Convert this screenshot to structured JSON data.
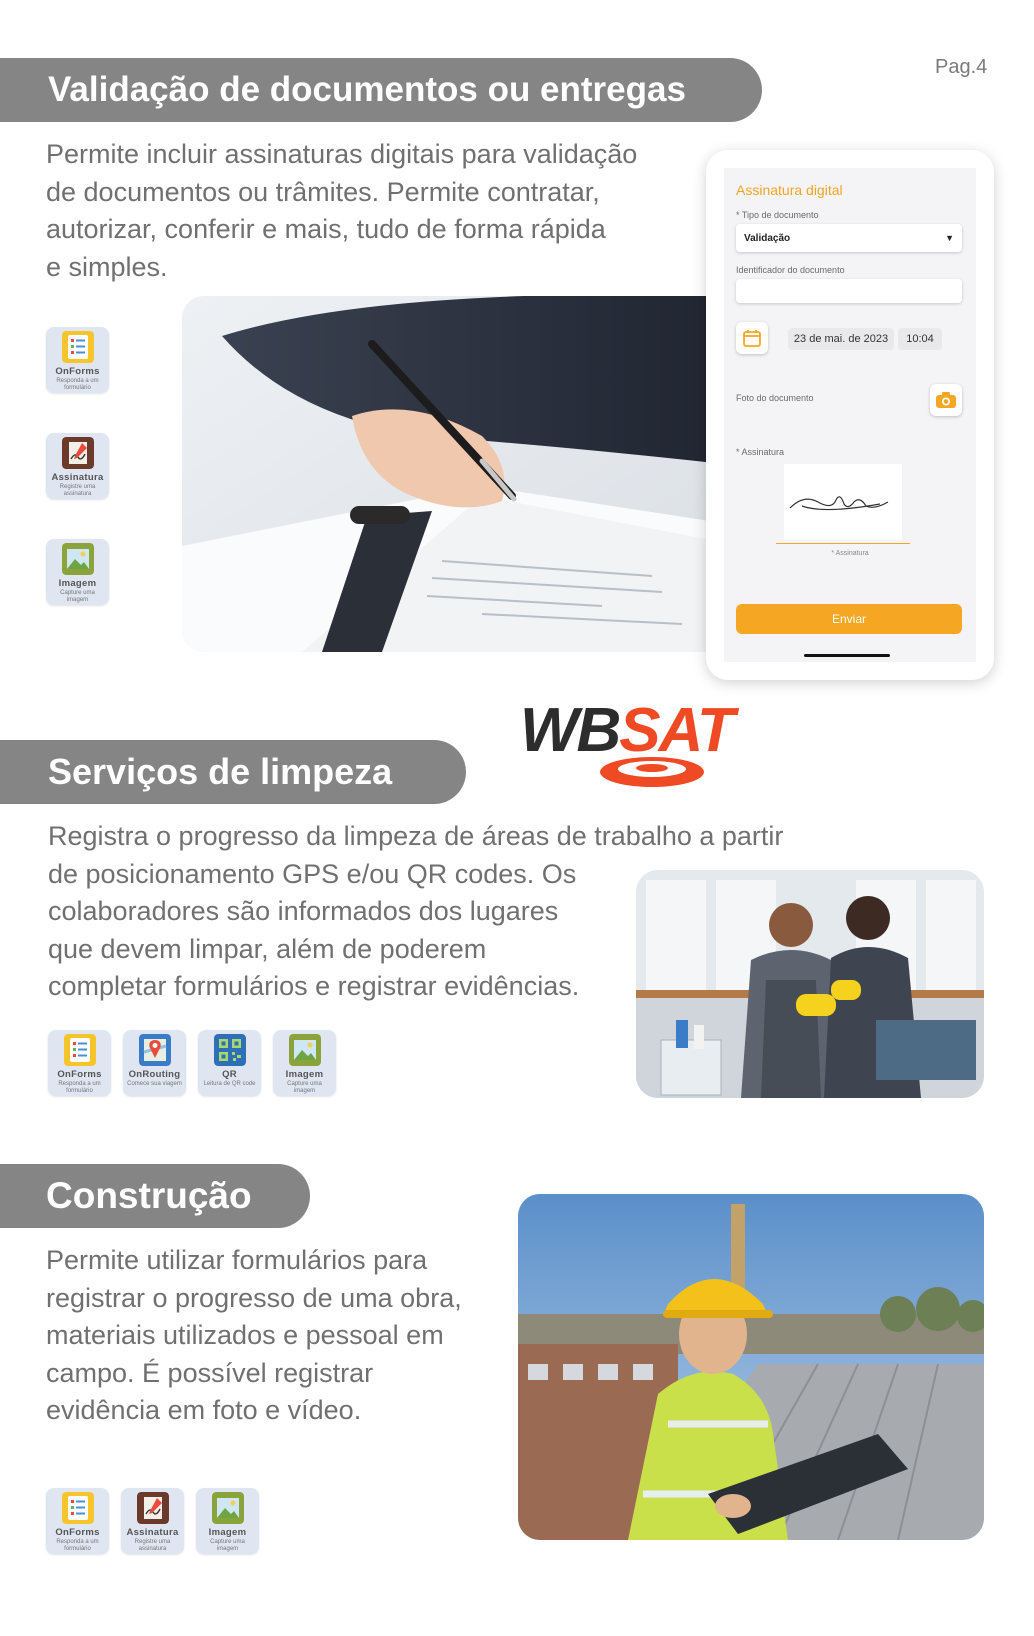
{
  "page_label": "Pag.4",
  "logo": {
    "text_left": "WB",
    "text_right": "SAT"
  },
  "sections": [
    {
      "title": "Validação de documentos ou entregas",
      "lines": [
        "Permite incluir assinaturas digitais para validação",
        "de documentos ou trâmites. Permite contratar,",
        "autorizar, conferir e mais, tudo de forma rápida",
        "e simples."
      ],
      "apps": [
        {
          "name": "OnForms",
          "sub": "Responda a um formulário"
        },
        {
          "name": "Assinatura",
          "sub": "Registre uma assinatura"
        },
        {
          "name": "Imagem",
          "sub": "Capture uma imagem"
        }
      ]
    },
    {
      "title": "Serviços de limpeza",
      "lines": [
        "Registra o progresso da limpeza de áreas de trabalho a partir",
        "de posicionamento GPS e/ou QR codes. Os",
        "colaboradores são informados dos lugares",
        "que devem limpar, além de poderem",
        "completar formulários e registrar evidências."
      ],
      "apps": [
        {
          "name": "OnForms",
          "sub": "Responda a um formulário"
        },
        {
          "name": "OnRouting",
          "sub": "Comece sua viagem"
        },
        {
          "name": "QR",
          "sub": "Leitura de QR code"
        },
        {
          "name": "Imagem",
          "sub": "Capture uma imagem"
        }
      ]
    },
    {
      "title": "Construção",
      "lines": [
        "Permite utilizar formulários para",
        "registrar o progresso de uma obra,",
        "materiais utilizados e pessoal em",
        "campo. É possível registrar",
        "evidência em foto e vídeo."
      ],
      "apps": [
        {
          "name": "OnForms",
          "sub": "Responda a um formulário"
        },
        {
          "name": "Assinatura",
          "sub": "Registre uma assinatura"
        },
        {
          "name": "Imagem",
          "sub": "Capture uma imagem"
        }
      ]
    }
  ],
  "phone": {
    "title": "Assinatura digital",
    "doc_type_label": "* Tipo de documento",
    "doc_type_value": "Validação",
    "doc_id_label": "Identificador do documento",
    "doc_id_value": "",
    "date": "23 de mai. de 2023",
    "time": "10:04",
    "photo_label": "Foto do documento",
    "signature_label": "* Assinatura",
    "signature_caption": "* Assinatura",
    "send_label": "Enviar"
  },
  "colors": {
    "section_bar": "#858585",
    "accent_orange": "#f5a623",
    "logo_dark": "#2d2d2d",
    "logo_orange": "#ef4a23"
  }
}
